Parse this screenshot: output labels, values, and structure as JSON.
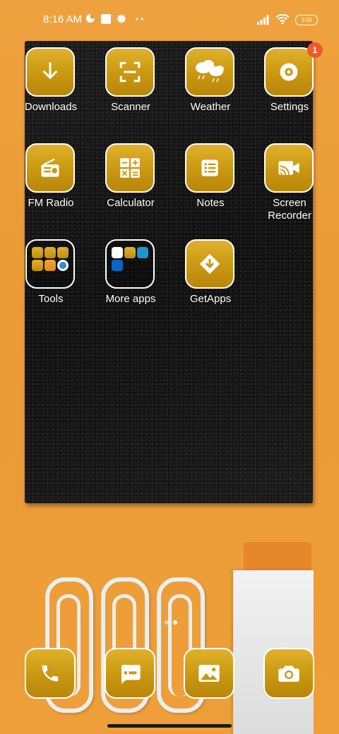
{
  "status_bar": {
    "time": "8:16 AM",
    "battery": "100"
  },
  "apps": [
    {
      "label": "Downloads",
      "icon": "download-arrow-icon"
    },
    {
      "label": "Scanner",
      "icon": "scan-frame-icon"
    },
    {
      "label": "Weather",
      "icon": "cloud-rain-icon"
    },
    {
      "label": "Settings",
      "icon": "gear-icon",
      "badge": "1"
    },
    {
      "label": "FM Radio",
      "icon": "radio-icon"
    },
    {
      "label": "Calculator",
      "icon": "calculator-icon"
    },
    {
      "label": "Notes",
      "icon": "list-icon"
    },
    {
      "label": "Screen Recorder",
      "icon": "screen-cast-icon"
    },
    {
      "label": "Tools",
      "icon": "folder-icon"
    },
    {
      "label": "More apps",
      "icon": "folder-icon"
    },
    {
      "label": "GetApps",
      "icon": "getapps-icon"
    }
  ],
  "dock": [
    {
      "icon": "phone-icon"
    },
    {
      "icon": "message-icon"
    },
    {
      "icon": "gallery-icon"
    },
    {
      "icon": "camera-icon"
    }
  ],
  "colors": {
    "icon_gold": "#c99710",
    "badge": "#f0582d",
    "wallpaper": "#eb9b35"
  }
}
